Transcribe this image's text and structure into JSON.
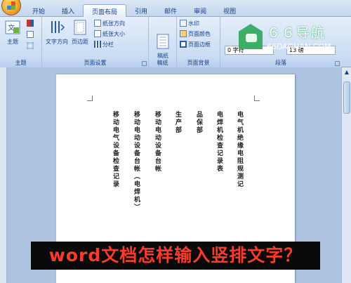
{
  "tabs": [
    {
      "label": "开始",
      "active": false
    },
    {
      "label": "插入",
      "active": false
    },
    {
      "label": "页面布局",
      "active": true
    },
    {
      "label": "引用",
      "active": false
    },
    {
      "label": "邮件",
      "active": false
    },
    {
      "label": "审阅",
      "active": false
    },
    {
      "label": "视图",
      "active": false
    }
  ],
  "ribbon": {
    "theme_group": {
      "label": "主题",
      "theme_button": "主题"
    },
    "page_setup": {
      "label": "页面设置",
      "text_direction": "文字方向",
      "margins": "页边距",
      "orientation": "纸张方向",
      "size": "纸张大小",
      "columns": "分栏"
    },
    "manuscript": {
      "label": "稿纸",
      "button": "稿纸\n设置"
    },
    "page_background": {
      "label": "页面背景",
      "watermark": "水印",
      "page_color": "页面颜色",
      "page_border": "页面边框"
    },
    "paragraph": {
      "label": "段落",
      "indent_value": "0 字符",
      "spacing_value": "13 磅"
    }
  },
  "watermark_badge": {
    "name": "６６导航",
    "url": "66DAOHAN.COM",
    "accent": "#3cae68"
  },
  "document": {
    "columns": [
      "电气机绝缘电阻规测记",
      "电焊机检查记录表",
      "品保部",
      "生产部",
      "移动电动设备台帐",
      "移动电动设备台帐（电焊机）",
      "移动电气设备检查记录"
    ]
  },
  "caption": "word文档怎样输入竖排文字？"
}
